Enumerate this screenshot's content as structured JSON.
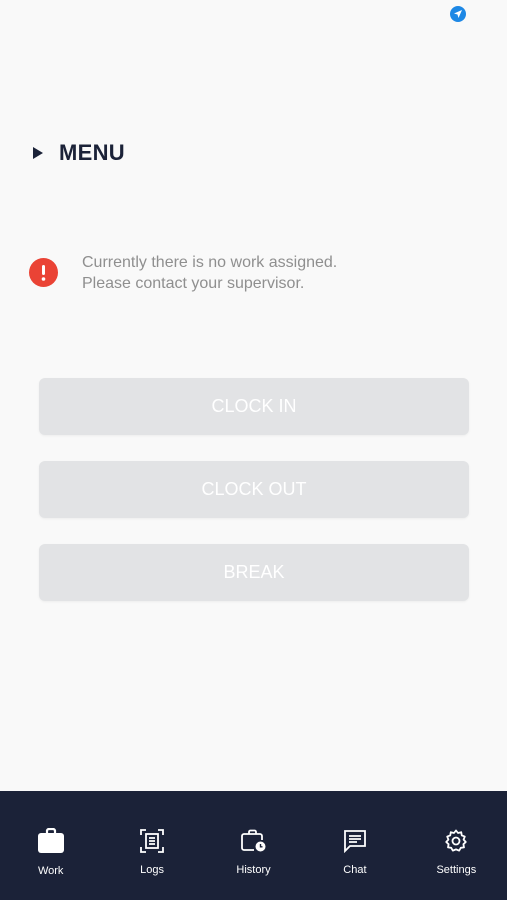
{
  "menu": {
    "label": "MENU"
  },
  "alert": {
    "line1": "Currently there is no work assigned.",
    "line2": "Please contact your supervisor."
  },
  "actions": {
    "clock_in": "CLOCK IN",
    "clock_out": "CLOCK OUT",
    "break": "BREAK"
  },
  "nav": {
    "items": [
      {
        "label": "Work",
        "icon": "briefcase-icon",
        "active": true
      },
      {
        "label": "Logs",
        "icon": "document-scan-icon",
        "active": false
      },
      {
        "label": "History",
        "icon": "history-clock-icon",
        "active": false
      },
      {
        "label": "Chat",
        "icon": "chat-icon",
        "active": false
      },
      {
        "label": "Settings",
        "icon": "gear-icon",
        "active": false
      }
    ]
  },
  "colors": {
    "background": "#f9f9f9",
    "primary_dark": "#1b2238",
    "alert_red": "#ea4335",
    "button_disabled": "#e2e3e5",
    "location_blue": "#1e88e5"
  }
}
